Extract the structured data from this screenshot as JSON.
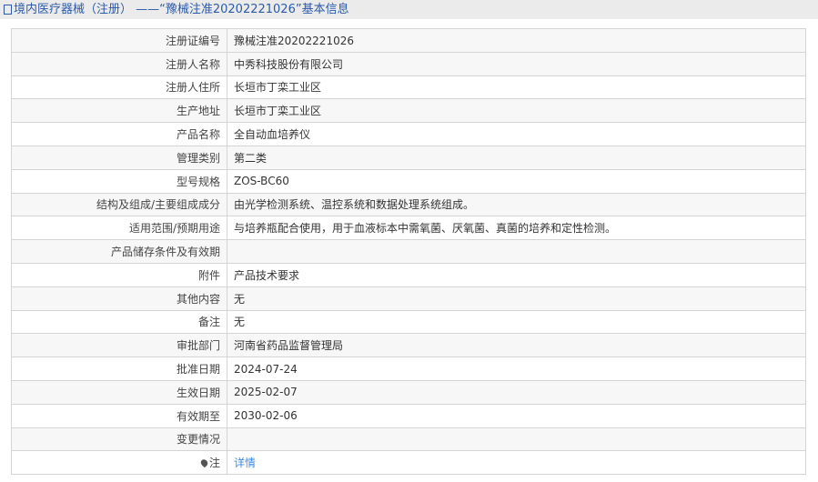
{
  "header": {
    "title": "境内医疗器械（注册） ——“豫械注准20202221026”基本信息"
  },
  "rows": [
    {
      "label": "注册证编号",
      "value": "豫械注准20202221026"
    },
    {
      "label": "注册人名称",
      "value": "中秀科技股份有限公司"
    },
    {
      "label": "注册人住所",
      "value": "长垣市丁栾工业区"
    },
    {
      "label": "生产地址",
      "value": "长垣市丁栾工业区"
    },
    {
      "label": "产品名称",
      "value": "全自动血培养仪"
    },
    {
      "label": "管理类别",
      "value": "第二类"
    },
    {
      "label": "型号规格",
      "value": "ZOS-BC60"
    },
    {
      "label": "结构及组成/主要组成成分",
      "value": "由光学检测系统、温控系统和数据处理系统组成。"
    },
    {
      "label": "适用范围/预期用途",
      "value": "与培养瓶配合使用，用于血液标本中需氧菌、厌氧菌、真菌的培养和定性检测。"
    },
    {
      "label": "产品储存条件及有效期",
      "value": ""
    },
    {
      "label": "附件",
      "value": "产品技术要求"
    },
    {
      "label": "其他内容",
      "value": "无"
    },
    {
      "label": "备注",
      "value": "无"
    },
    {
      "label": "审批部门",
      "value": "河南省药品监督管理局"
    },
    {
      "label": "批准日期",
      "value": "2024-07-24"
    },
    {
      "label": "生效日期",
      "value": "2025-02-07"
    },
    {
      "label": "有效期至",
      "value": "2030-02-06"
    },
    {
      "label": "变更情况",
      "value": ""
    }
  ],
  "note": {
    "label": "注",
    "link": "详情"
  }
}
